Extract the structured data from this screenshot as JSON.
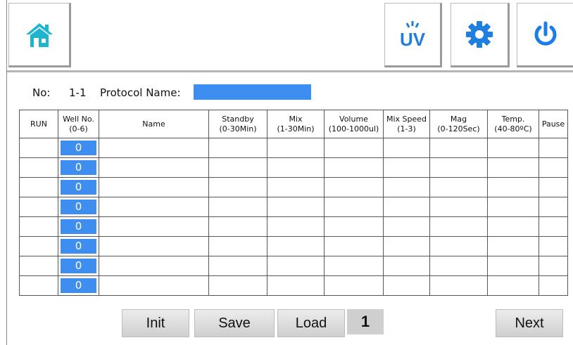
{
  "toolbar": {
    "icons": [
      "home-icon",
      "uv-lamp-icon",
      "gear-icon",
      "power-icon"
    ],
    "uv_label": "UV"
  },
  "protocol": {
    "no_label": "No:",
    "no_value": "1-1",
    "name_label": "Protocol Name:",
    "name_value": ""
  },
  "table": {
    "headers": [
      [
        "RUN",
        ""
      ],
      [
        "Well No.",
        "(0-6)"
      ],
      [
        "Name",
        ""
      ],
      [
        "Standby",
        "(0-30Min)"
      ],
      [
        "Mix",
        "(1-30Min)"
      ],
      [
        "Volume",
        "(100-1000ul)"
      ],
      [
        "Mix Speed",
        "(1-3)"
      ],
      [
        "Mag",
        "(0-120Sec)"
      ],
      [
        "Temp.",
        "(40-80ºC)"
      ],
      [
        "Pause",
        ""
      ]
    ],
    "wells": [
      "0",
      "0",
      "0",
      "0",
      "0",
      "0",
      "0",
      "0"
    ]
  },
  "footer": {
    "init_label": "Init",
    "save_label": "Save",
    "load_label": "Load",
    "page": "1",
    "next_label": "Next"
  },
  "colors": {
    "accent": "#3d8ef0",
    "home_icon": "#1fb5cf",
    "toolbar_icons": "#1e7fe0",
    "power_icon": "#1a7de8"
  }
}
